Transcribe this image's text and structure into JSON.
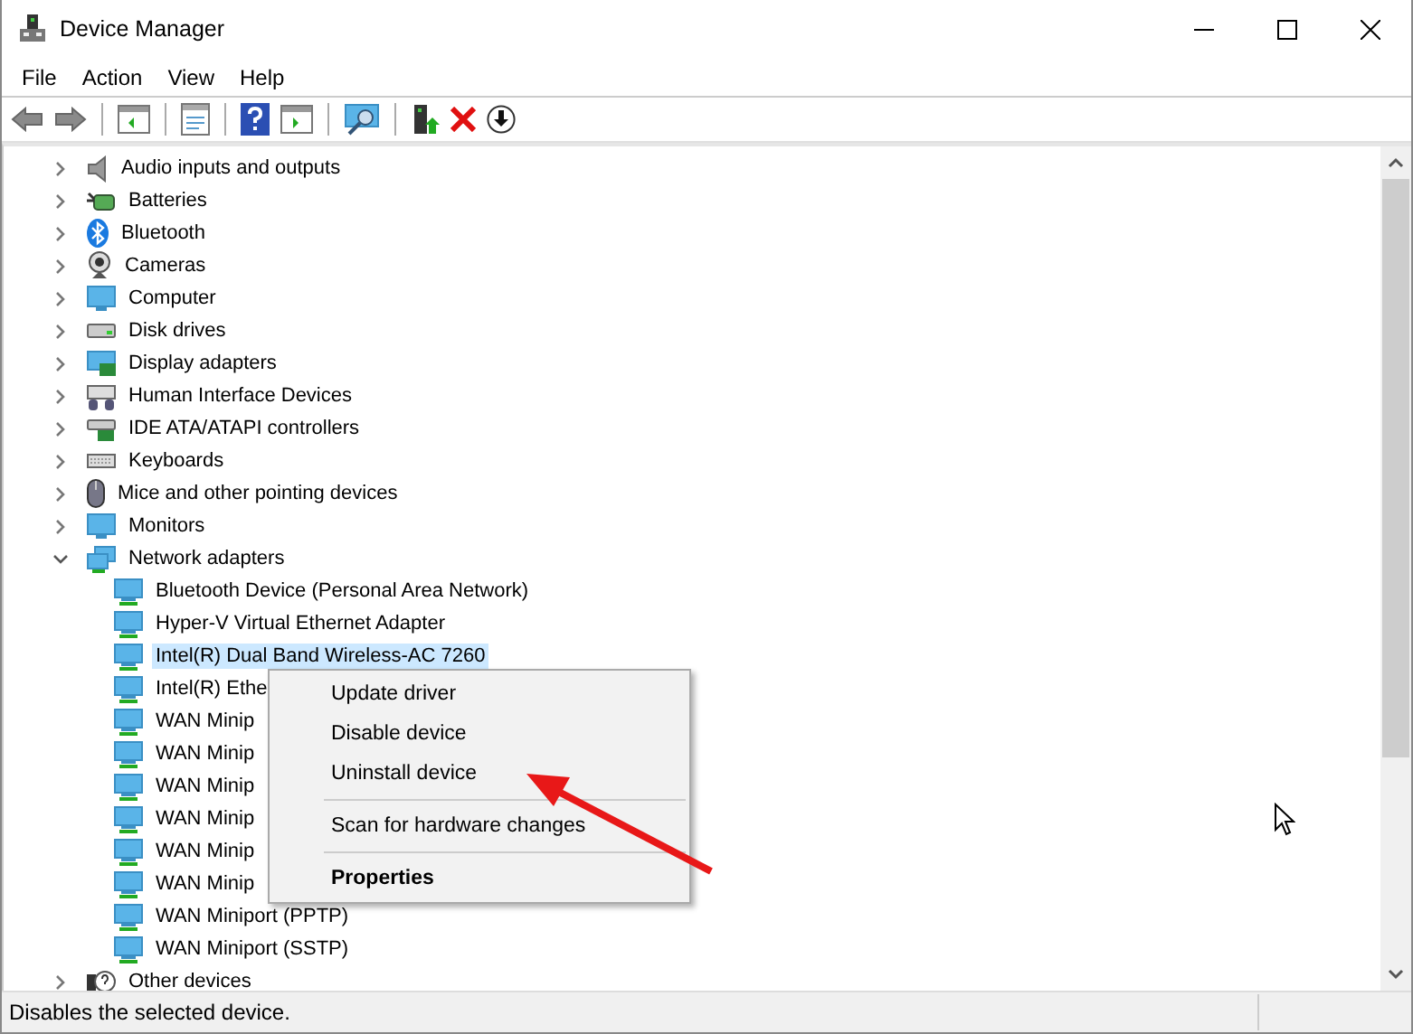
{
  "window": {
    "title": "Device Manager"
  },
  "menu": [
    "File",
    "Action",
    "View",
    "Help"
  ],
  "tree": [
    {
      "label": "Audio inputs and outputs",
      "expanded": false,
      "selected": false
    },
    {
      "label": "Batteries",
      "expanded": false,
      "selected": false
    },
    {
      "label": "Bluetooth",
      "expanded": false,
      "selected": false
    },
    {
      "label": "Cameras",
      "expanded": false,
      "selected": false
    },
    {
      "label": "Computer",
      "expanded": false,
      "selected": false
    },
    {
      "label": "Disk drives",
      "expanded": false,
      "selected": false
    },
    {
      "label": "Display adapters",
      "expanded": false,
      "selected": false
    },
    {
      "label": "Human Interface Devices",
      "expanded": false,
      "selected": false
    },
    {
      "label": "IDE ATA/ATAPI controllers",
      "expanded": false,
      "selected": false
    },
    {
      "label": "Keyboards",
      "expanded": false,
      "selected": false
    },
    {
      "label": "Mice and other pointing devices",
      "expanded": false,
      "selected": false
    },
    {
      "label": "Monitors",
      "expanded": false,
      "selected": false
    },
    {
      "label": "Network adapters",
      "expanded": true,
      "selected": false,
      "children": [
        {
          "label": "Bluetooth Device (Personal Area Network)",
          "selected": false
        },
        {
          "label": "Hyper-V Virtual Ethernet Adapter",
          "selected": false
        },
        {
          "label": "Intel(R) Dual Band Wireless-AC 7260",
          "selected": true
        },
        {
          "label": "Intel(R) Ethe",
          "selected": false
        },
        {
          "label": "WAN Minip",
          "selected": false
        },
        {
          "label": "WAN Minip",
          "selected": false
        },
        {
          "label": "WAN Minip",
          "selected": false
        },
        {
          "label": "WAN Minip",
          "selected": false
        },
        {
          "label": "WAN Minip",
          "selected": false
        },
        {
          "label": "WAN Minip",
          "selected": false
        },
        {
          "label": "WAN Miniport (PPTP)",
          "selected": false
        },
        {
          "label": "WAN Miniport (SSTP)",
          "selected": false
        }
      ]
    },
    {
      "label": "Other devices",
      "expanded": false,
      "selected": false
    }
  ],
  "context_menu": [
    {
      "kind": "item",
      "label": "Update driver",
      "default": false
    },
    {
      "kind": "item",
      "label": "Disable device",
      "default": false
    },
    {
      "kind": "item",
      "label": "Uninstall device",
      "default": false
    },
    {
      "kind": "separator"
    },
    {
      "kind": "item",
      "label": "Scan for hardware changes",
      "default": false
    },
    {
      "kind": "separator"
    },
    {
      "kind": "item",
      "label": "Properties",
      "default": true
    }
  ],
  "status_bar": "Disables the selected device."
}
